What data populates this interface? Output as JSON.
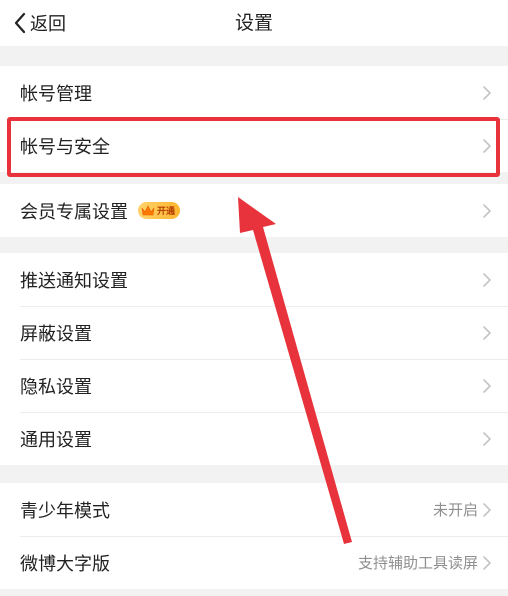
{
  "header": {
    "back_label": "返回",
    "title": "设置"
  },
  "groups": [
    {
      "items": [
        {
          "label": "帐号管理"
        },
        {
          "label": "帐号与安全"
        }
      ]
    },
    {
      "items": [
        {
          "label": "会员专属设置",
          "badge": "开通"
        }
      ]
    },
    {
      "items": [
        {
          "label": "推送通知设置"
        },
        {
          "label": "屏蔽设置"
        },
        {
          "label": "隐私设置"
        },
        {
          "label": "通用设置"
        }
      ]
    },
    {
      "items": [
        {
          "label": "青少年模式",
          "value": "未开启"
        },
        {
          "label": "微博大字版",
          "value": "支持辅助工具读屏"
        }
      ]
    }
  ],
  "colors": {
    "annotation": "#e8333c",
    "vip_badge": "#ffc24a",
    "secondary_text": "#8f8f8f",
    "chevron": "#c4c4c4"
  },
  "icons": {
    "back": "chevron-left-icon",
    "row_arrow": "chevron-right-icon",
    "vip": "crown-icon"
  }
}
